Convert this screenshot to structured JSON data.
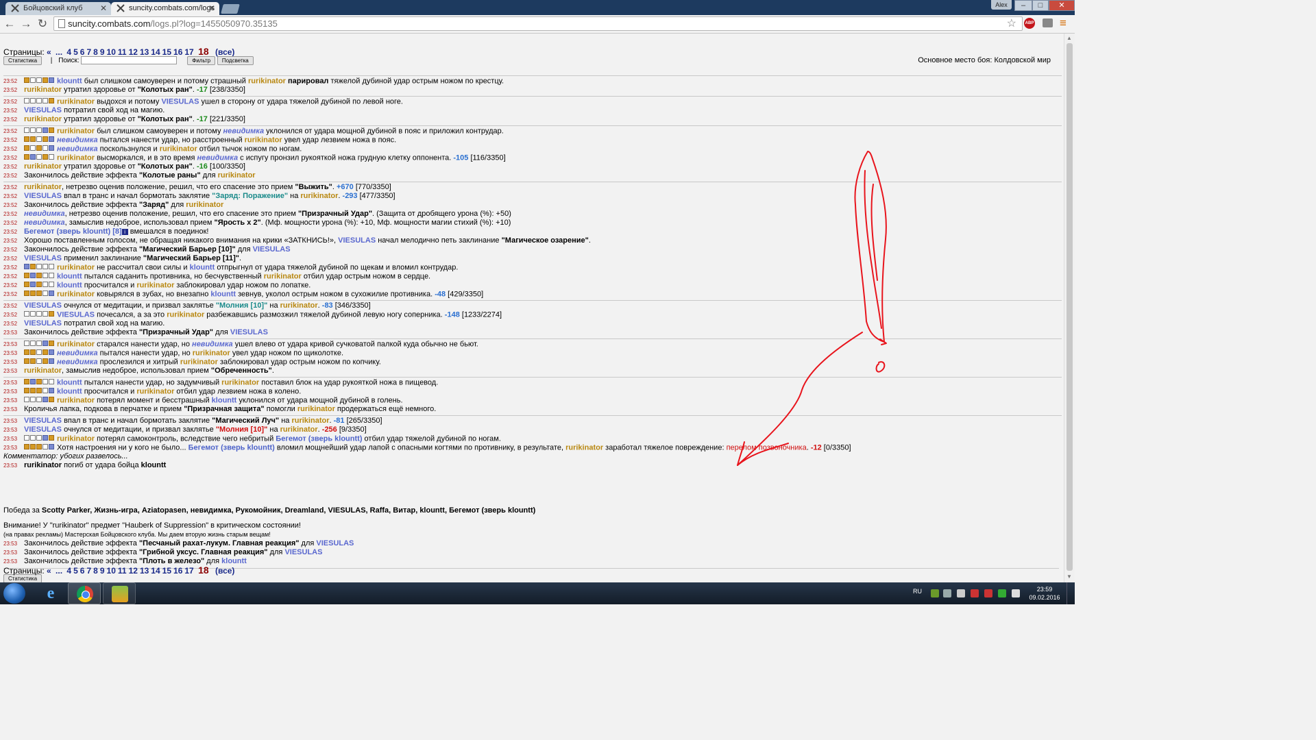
{
  "browser": {
    "tabs": [
      {
        "title": "Бойцовский клуб"
      },
      {
        "title": "suncity.combats.com/logs"
      }
    ],
    "profile_name": "Alex",
    "window_buttons": {
      "min": "–",
      "max": "□",
      "close": "✕"
    },
    "url_host": "suncity.combats.com",
    "url_path": "/logs.pl?log=1455050970.35135",
    "abp_label": "ABP"
  },
  "page": {
    "pages_label": "Страницы:",
    "page_first": "«",
    "page_ellipsis": "...",
    "page_links": [
      "4",
      "5",
      "6",
      "7",
      "8",
      "9",
      "10",
      "11",
      "12",
      "13",
      "14",
      "15",
      "16",
      "17"
    ],
    "page_current": "18",
    "page_all": "(все)",
    "stats_button": "Статистика",
    "search_label": "Поиск:",
    "filter_button": "Фильтр",
    "highlight_button": "Подсветка",
    "battle_place": "Основное место боя: Колдовской мир",
    "victory_prefix": "Победа за",
    "victory_list": "Scotty Parker, Жизнь-игра, Aziatopasen, невидимка, Рукомойник, Dreamland, VIESULAS, Raffa, Витар, klountt, Бегемот (зверь klountt)",
    "warning": "Внимание! У \"rurikinator\" предмет \"Hauberk of Suppression\" в критическом состоянии!",
    "ad": "(на правах рекламы) Мастерская Бойцовского клуба. Мы даем вторую жизнь старым вещам!",
    "effects_end": [
      {
        "time": "23:53",
        "text": "Закончилось действие эффекта ",
        "effect": "\"Песчаный рахат-лукум. Главная реакция\"",
        "for": " для ",
        "target": "VIESULAS"
      },
      {
        "time": "23:53",
        "text": "Закончилось действие эффекта ",
        "effect": "\"Грибной уксус. Главная реакция\"",
        "for": " для ",
        "target": "VIESULAS"
      },
      {
        "time": "23:53",
        "text": "Закончилось действие эффекта ",
        "effect": "\"Плоть в железо\"",
        "for": " для ",
        "target": "klountt"
      }
    ]
  },
  "log": {
    "times": [
      "23:52",
      "23:52",
      "23:52",
      "23:52",
      "23:52",
      "23:52",
      "23:52",
      "23:52",
      "23:52",
      "23:52",
      "23:52",
      "23:52",
      "23:52",
      "23:52",
      "23:52",
      "23:52",
      "23:52",
      "23:52",
      "23:52",
      "23:52",
      "23:52",
      "23:52",
      "23:52",
      "23:52",
      "23:52",
      "23:52",
      "23:52",
      "23:53",
      "23:53",
      "23:53",
      "23:53",
      "23:53",
      "23:53",
      "23:53",
      "23:53",
      "23:53",
      "23:53",
      "23:53",
      "23:53",
      "23:53",
      "23:53",
      "23:53",
      "23:53",
      "23:53",
      "23:53"
    ],
    "n": {
      "klountt": "klountt",
      "rurikinator": "rurikinator",
      "viesulas": "VIESULAS",
      "nevidimka": "невидимка",
      "begemot": "Бегемот (зверь klountt)",
      "begemot8": "Бегемот (зверь klountt) [8]"
    }
  },
  "taskbar": {
    "lang": "RU",
    "time": "23:59",
    "date": "09.02.2016"
  }
}
